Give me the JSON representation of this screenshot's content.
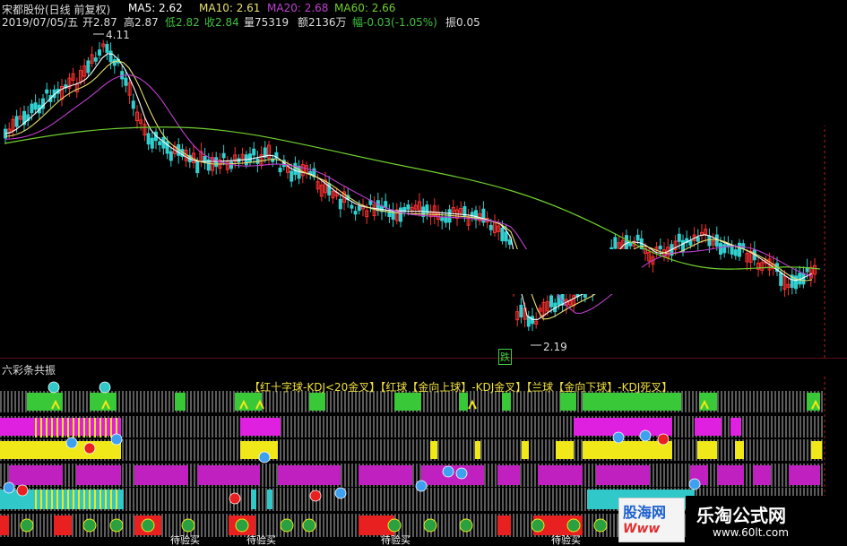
{
  "header": {
    "stock_line": "宋都股份(日线 前复权)",
    "ma5": "MA5: 2.62",
    "ma10": "MA10: 2.61",
    "ma20": "MA20: 2.68",
    "ma60": "MA60: 2.66",
    "date": "2019/07/05/五",
    "open": "开2.87",
    "high": "高2.87",
    "low": "低2.82",
    "close": "收2.84",
    "volume": "量75319",
    "amount": "额2136万",
    "change": "幅-0.03(-1.05%)",
    "amplitude": "振0.05"
  },
  "chart": {
    "high_marker": "4.11",
    "low_marker": "2.19",
    "fall_tag": "跌",
    "ma_colors": {
      "ma5": "#ffffff",
      "ma10": "#e8e070",
      "ma20": "#c040d0",
      "ma60": "#70d030"
    }
  },
  "indicator": {
    "name": "六彩条共振",
    "legend": "【红十字球-KDJ<20金叉】【红球【金向上球】-KDJ金叉】【兰球【金向下球】-KDJ死叉】",
    "buy_label": "待验买"
  },
  "watermarks": {
    "left_top": "股海网",
    "left_bottom": "Www",
    "right_title": "乐淘公式网",
    "right_url": "www.60lt.com"
  }
}
